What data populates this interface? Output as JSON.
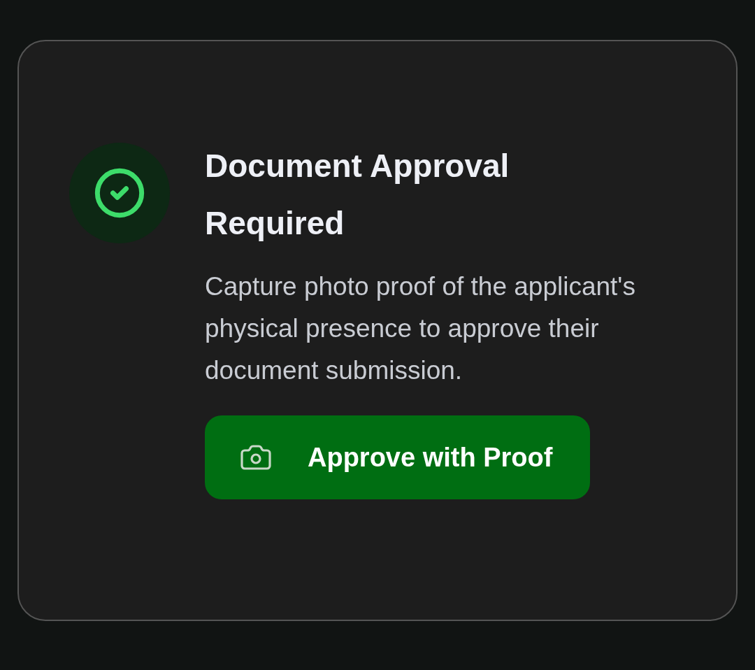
{
  "card": {
    "title": "Document Approval Required",
    "description": "Capture photo proof of the applicant's physical presence to approve their document submission.",
    "button": {
      "label": "Approve with Proof"
    }
  }
}
